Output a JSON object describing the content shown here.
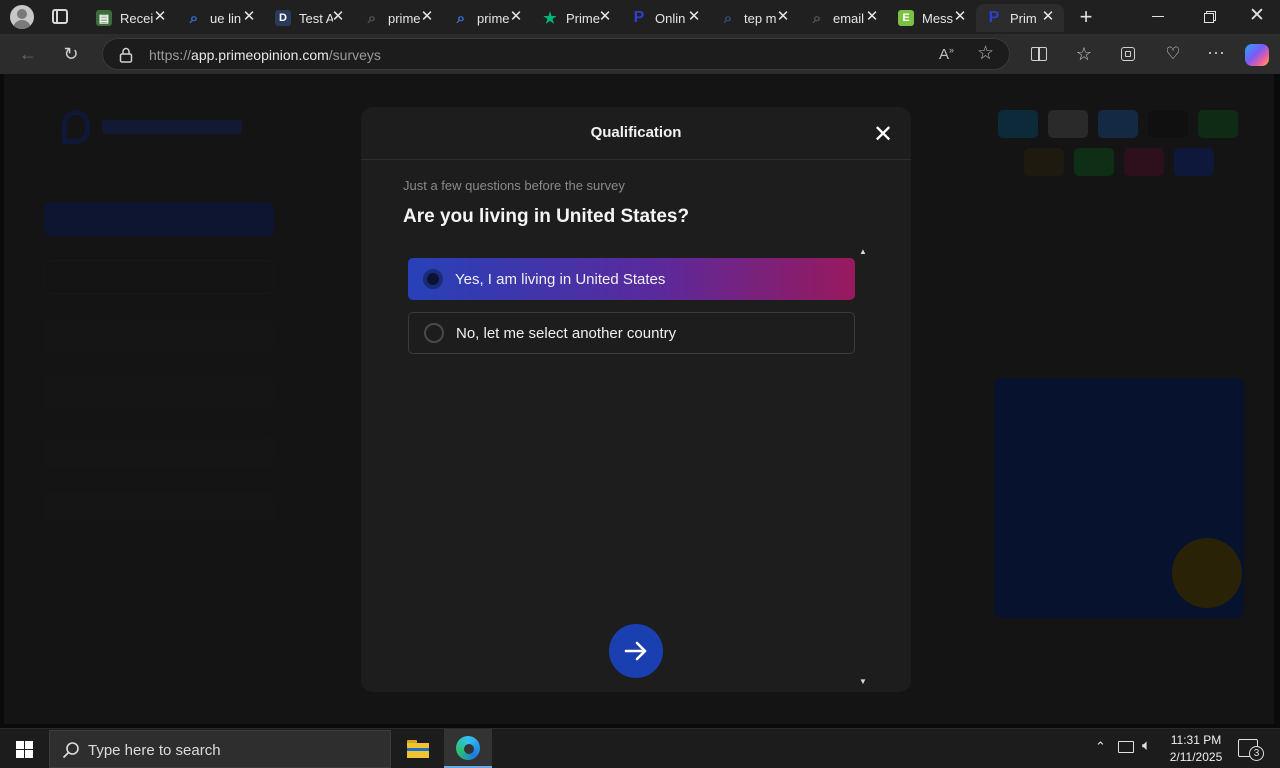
{
  "browser": {
    "tabs": [
      {
        "title": "Recei",
        "icon": "sheets-icon",
        "color": "#3b6e3b"
      },
      {
        "title": "ue lin",
        "icon": "search-icon",
        "color": "#3a6fd8"
      },
      {
        "title": "Test A",
        "icon": "d-logo-icon",
        "color": "#2a3a5a"
      },
      {
        "title": "prime",
        "icon": "search-icon",
        "color": "#555555"
      },
      {
        "title": "prime",
        "icon": "search-icon",
        "color": "#3a6fd8"
      },
      {
        "title": "Prime",
        "icon": "star-icon",
        "color": "#00b67a"
      },
      {
        "title": "Onlin",
        "icon": "primeopinion-icon",
        "color": "#2c3fd0"
      },
      {
        "title": "tep m",
        "icon": "search-icon",
        "color": "#3a4a70"
      },
      {
        "title": "email",
        "icon": "search-icon",
        "color": "#555555"
      },
      {
        "title": "Mess",
        "icon": "e-logo-icon",
        "color": "#7bc143"
      },
      {
        "title": "Prim",
        "icon": "primeopinion-icon",
        "color": "#2c3fd0"
      }
    ],
    "url_prefix": "https://",
    "url_host": "app.primeopinion.com",
    "url_path": "/surveys"
  },
  "modal": {
    "title": "Qualification",
    "subheading": "Just a few questions before the survey",
    "question": "Are you living in United States?",
    "options": [
      {
        "label": "Yes, I am living in United States",
        "selected": true
      },
      {
        "label": "No, let me select another country",
        "selected": false
      }
    ]
  },
  "taskbar": {
    "search_placeholder": "Type here to search",
    "time": "11:31 PM",
    "date": "2/11/2025",
    "notification_count": "3"
  }
}
